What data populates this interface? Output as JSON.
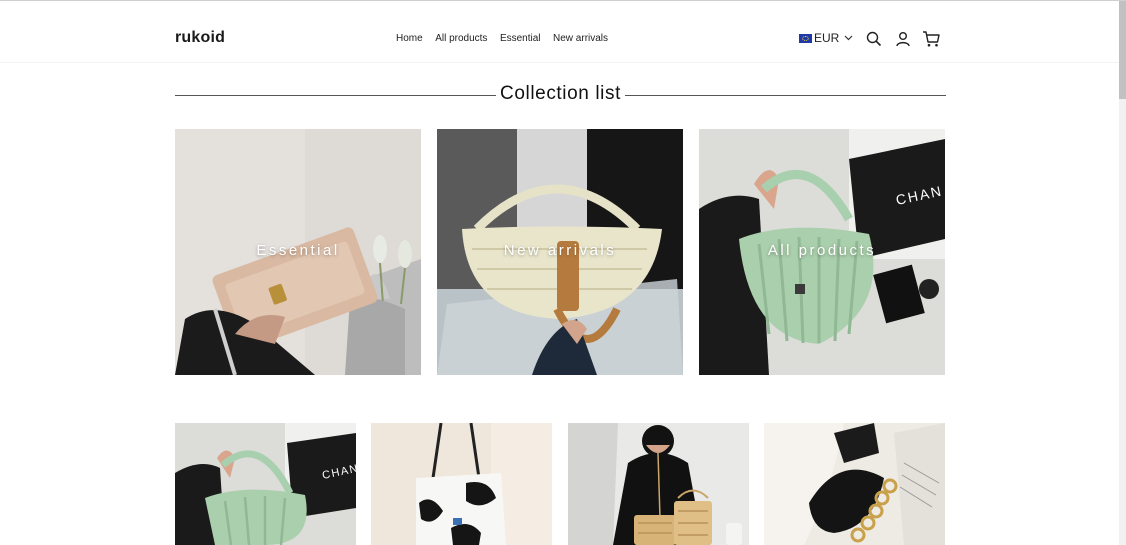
{
  "header": {
    "logo": "rukoid",
    "nav": [
      "Home",
      "All products",
      "Essential",
      "New arrivals"
    ],
    "currency": "EUR"
  },
  "section": {
    "title": "Collection list"
  },
  "collections": [
    {
      "label": "Essential",
      "image_icon": "woven-clutch-bag"
    },
    {
      "label": "New arrivals",
      "image_icon": "rattan-basket-bag"
    },
    {
      "label": "All products",
      "image_icon": "pleated-green-bag"
    }
  ],
  "products": [
    {
      "image_icon": "pleated-green-bag"
    },
    {
      "image_icon": "cow-print-tote"
    },
    {
      "image_icon": "rattan-box-bag"
    },
    {
      "image_icon": "black-chain-bag"
    }
  ],
  "colors": {
    "accent": "#111111",
    "divider": "#555555",
    "flag": "#1f3aa6"
  }
}
